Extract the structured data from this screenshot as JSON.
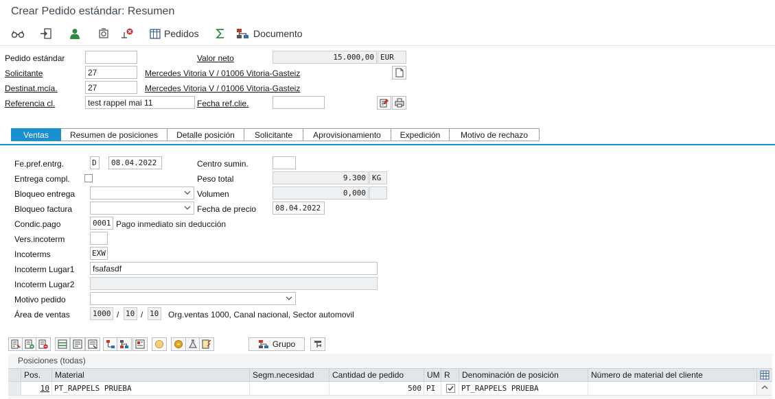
{
  "window": {
    "title": "Crear Pedido estándar: Resumen"
  },
  "toolbar": {
    "pedidos_label": "Pedidos",
    "documento_label": "Documento",
    "icons": [
      "glasses-icon",
      "exit-icon",
      "person-icon",
      "refresh-icon",
      "delete-icon",
      "grid-icon",
      "sum-icon",
      "hierarchy-icon"
    ]
  },
  "header": {
    "pedido_estandar_label": "Pedido estándar",
    "pedido_estandar_value": "",
    "valor_neto_label": "Valor neto",
    "valor_neto_value": "15.000,00",
    "valor_neto_currency": "EUR",
    "solicitante_label": "Solicitante",
    "solicitante_value": "27",
    "solicitante_desc": "Mercedes Vitoria V / 01006 Vitoria-Gasteiz",
    "destinat_label": "Destinat.mcía.",
    "destinat_value": "27",
    "destinat_desc": "Mercedes Vitoria V / 01006 Vitoria-Gasteiz",
    "referencia_label": "Referencia cl.",
    "referencia_value": "test rappel mai 11",
    "fecha_ref_label": "Fecha ref.clie.",
    "fecha_ref_value": ""
  },
  "tabs": [
    {
      "label": "Ventas",
      "active": true
    },
    {
      "label": "Resumen de posiciones",
      "active": false
    },
    {
      "label": "Detalle posición",
      "active": false
    },
    {
      "label": "Solicitante",
      "active": false
    },
    {
      "label": "Aprovisionamiento",
      "active": false
    },
    {
      "label": "Expedición",
      "active": false
    },
    {
      "label": "Motivo de rechazo",
      "active": false
    }
  ],
  "ventas": {
    "fe_pref_label": "Fe.pref.entrg.",
    "fe_pref_type": "D",
    "fe_pref_date": "08.04.2022",
    "centro_label": "Centro sumin.",
    "centro_value": "",
    "entrega_compl_label": "Entrega compl.",
    "entrega_compl_checked": false,
    "peso_total_label": "Peso total",
    "peso_total_value": "9.300",
    "peso_total_unit": "KG",
    "bloqueo_entrega_label": "Bloqueo entrega",
    "bloqueo_entrega_value": "",
    "volumen_label": "Volumen",
    "volumen_value": "0,000",
    "volumen_unit": "",
    "bloqueo_factura_label": "Bloqueo factura",
    "bloqueo_factura_value": "",
    "fecha_precio_label": "Fecha de precio",
    "fecha_precio_value": "08.04.2022",
    "condic_pago_label": "Condic.pago",
    "condic_pago_value": "0001",
    "condic_pago_desc": "Pago inmediato sin deducción",
    "vers_incoterm_label": "Vers.incoterm",
    "vers_incoterm_value": "",
    "incoterms_label": "Incoterms",
    "incoterms_value": "EXW",
    "lugar1_label": "Incoterm Lugar1",
    "lugar1_value": "fsafasdf",
    "lugar2_label": "Incoterm Lugar2",
    "lugar2_value": "",
    "motivo_label": "Motivo pedido",
    "motivo_value": "",
    "area_label": "Área de ventas",
    "area_org": "1000",
    "area_canal": "10",
    "area_sector": "10",
    "area_sep": "/",
    "area_desc": "Org.ventas 1000, Canal nacional, Sector automovil"
  },
  "item_toolbar": {
    "grupo_label": "Grupo"
  },
  "positions": {
    "title": "Posiciones (todas)",
    "columns": {
      "pos": "Pos.",
      "material": "Material",
      "segm": "Segm.necesidad",
      "cantidad": "Cantidad de pedido",
      "um": "UM",
      "r": "R",
      "denominacion": "Denominación de posición",
      "num_cliente": "Número de material del cliente"
    },
    "rows": [
      {
        "pos": "10",
        "material": "PT_RAPPELS PRUEBA",
        "segm": "",
        "cantidad": "500",
        "um": "PI",
        "r_checked": true,
        "denominacion": "PT_RAPPELS PRUEBA",
        "num_cliente": ""
      }
    ]
  }
}
